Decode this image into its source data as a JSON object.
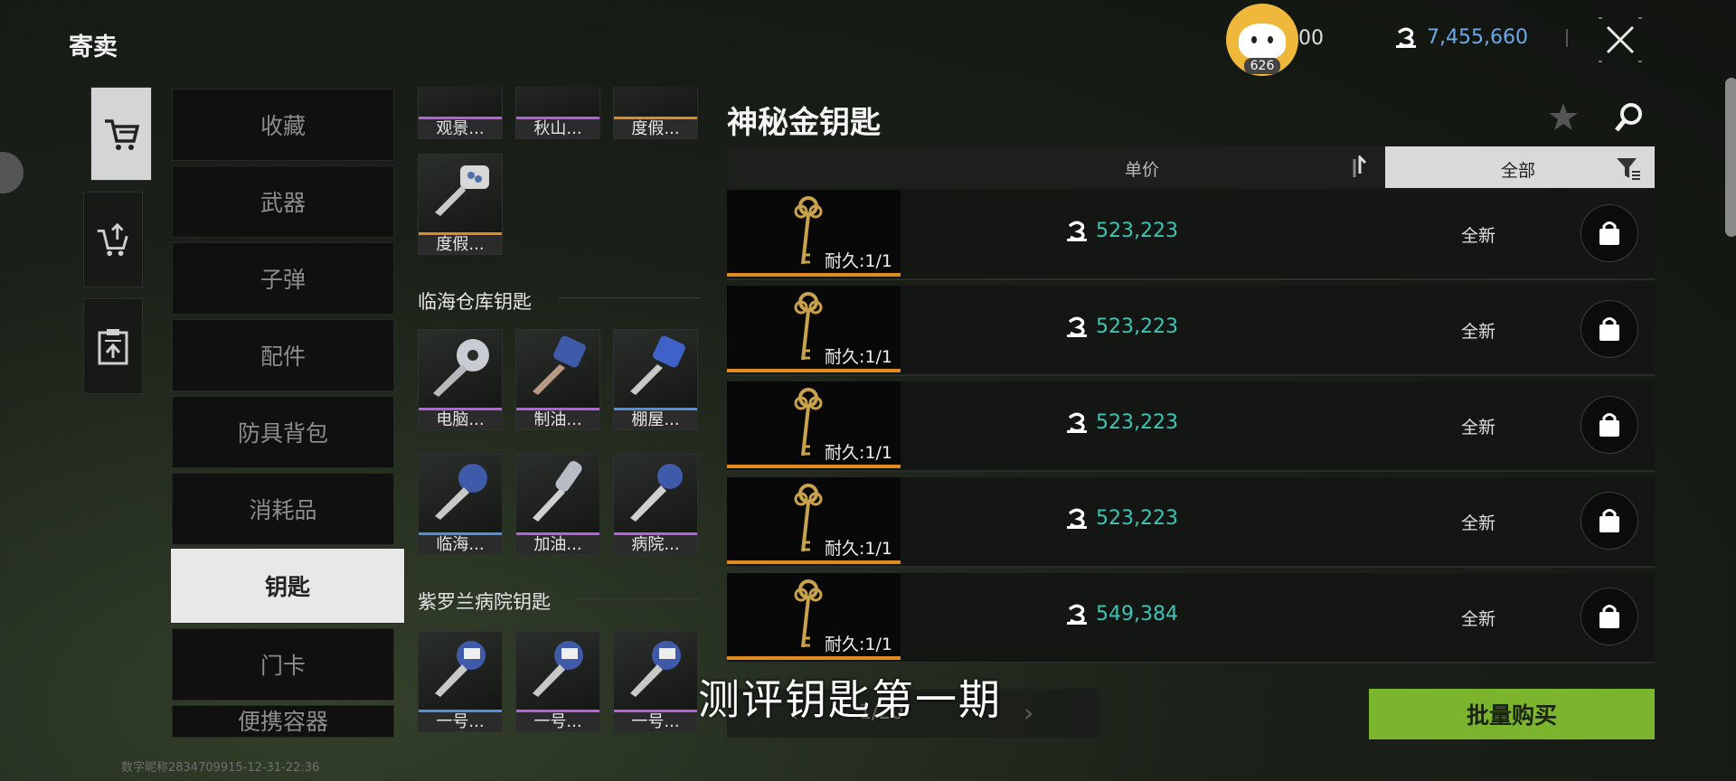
{
  "header": {
    "title": "寄卖",
    "avatar_badge": "626",
    "points": "00",
    "currency_icon": "coin-icon",
    "currency": "7,455,660",
    "close_icon": "close-icon"
  },
  "side_tabs": [
    {
      "name": "cart-icon",
      "active": true
    },
    {
      "name": "sell-cart-icon",
      "active": false
    },
    {
      "name": "clipboard-icon",
      "active": false
    }
  ],
  "categories": [
    "收藏",
    "武器",
    "子弹",
    "配件",
    "防具背包",
    "消耗品",
    "钥匙",
    "门卡",
    "便携容器"
  ],
  "active_category": "钥匙",
  "key_sections": {
    "top_row": [
      {
        "label": "观景...",
        "bar": "#b65fe0"
      },
      {
        "label": "秋山...",
        "bar": "#b65fe0"
      },
      {
        "label": "度假...",
        "bar": "#e38a1e"
      }
    ],
    "single": {
      "label": "度假...",
      "bar": "#e38a1e"
    },
    "section1_title": "临海仓库钥匙",
    "section1": [
      {
        "label": "电脑...",
        "bar": "#b65fe0"
      },
      {
        "label": "制油...",
        "bar": "#b65fe0"
      },
      {
        "label": "棚屋...",
        "bar": "#4f8fe0"
      },
      {
        "label": "临海...",
        "bar": "#4f8fe0"
      },
      {
        "label": "加油...",
        "bar": "#b65fe0"
      },
      {
        "label": "病院...",
        "bar": "#b65fe0"
      }
    ],
    "section2_title": "紫罗兰病院钥匙",
    "section2": [
      {
        "label": "一号...",
        "bar": "#4f8fe0"
      },
      {
        "label": "一号...",
        "bar": "#b65fe0"
      },
      {
        "label": "一号...",
        "bar": "#b65fe0"
      }
    ]
  },
  "detail": {
    "title": "神秘金钥匙",
    "favorite_icon": "star-icon",
    "search_icon": "search-icon",
    "column_price": "单价",
    "sort_icon": "sort-icon",
    "filter_label": "全部",
    "filter_icon": "filter-icon"
  },
  "listings": [
    {
      "durability": "耐久:1/1",
      "price": "523,223",
      "condition": "全新"
    },
    {
      "durability": "耐久:1/1",
      "price": "523,223",
      "condition": "全新"
    },
    {
      "durability": "耐久:1/1",
      "price": "523,223",
      "condition": "全新"
    },
    {
      "durability": "耐久:1/1",
      "price": "523,223",
      "condition": "全新"
    },
    {
      "durability": "耐久:1/1",
      "price": "549,384",
      "condition": "全新"
    }
  ],
  "pager": {
    "text": "1/20"
  },
  "bulk_buy": "批量购买",
  "subtitle": "测评钥匙第一期",
  "footer_id": "数字昵称2834709915-12-31-22:36",
  "colors": {
    "accent_green": "#7ab52d",
    "price_teal": "#3cc4b5",
    "currency_blue": "#6fa9e8",
    "rarity_orange": "#e38a1e",
    "rarity_purple": "#b65fe0",
    "rarity_blue": "#4f8fe0"
  }
}
